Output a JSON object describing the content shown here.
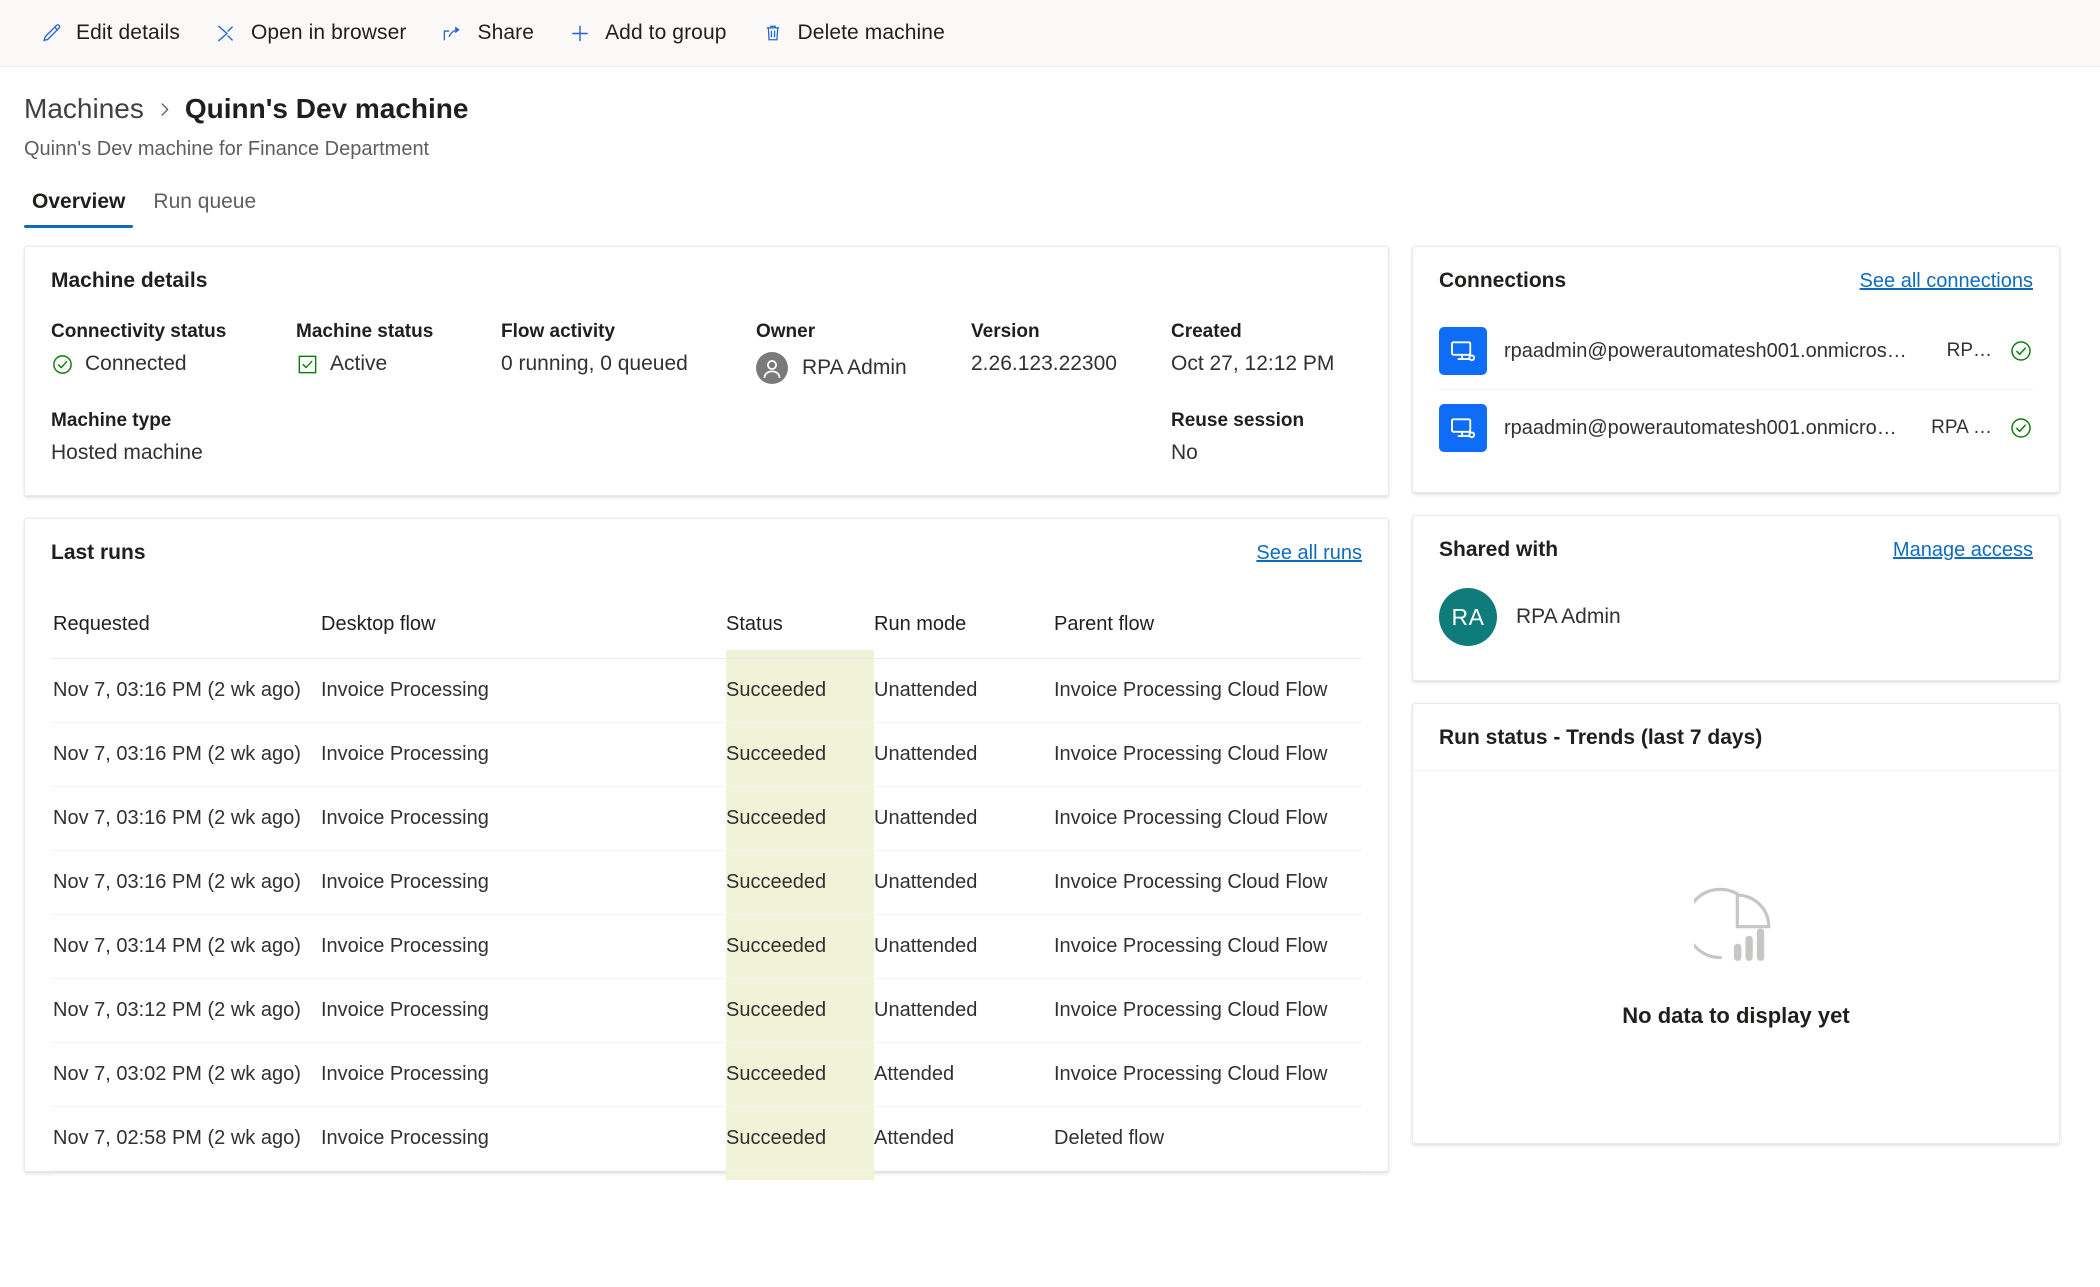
{
  "toolbar": {
    "items": [
      {
        "label": "Edit details",
        "icon": "pencil-icon",
        "name": "edit-details-button"
      },
      {
        "label": "Open in browser",
        "icon": "open-in-browser-icon",
        "name": "open-in-browser-button"
      },
      {
        "label": "Share",
        "icon": "share-icon",
        "name": "share-button"
      },
      {
        "label": "Add to group",
        "icon": "plus-icon",
        "name": "add-to-group-button"
      },
      {
        "label": "Delete machine",
        "icon": "trash-icon",
        "name": "delete-machine-button"
      }
    ]
  },
  "header": {
    "breadcrumb_parent": "Machines",
    "breadcrumb_separator": "›",
    "title": "Quinn's Dev machine",
    "subtitle": "Quinn's Dev machine for Finance Department"
  },
  "tabs": [
    {
      "label": "Overview",
      "active": true
    },
    {
      "label": "Run queue",
      "active": false
    }
  ],
  "machine_details": {
    "title": "Machine details",
    "fields": {
      "connectivity_status_label": "Connectivity status",
      "connectivity_status_value": "Connected",
      "machine_status_label": "Machine status",
      "machine_status_value": "Active",
      "flow_activity_label": "Flow activity",
      "flow_activity_value": "0 running, 0 queued",
      "owner_label": "Owner",
      "owner_value": "RPA Admin",
      "version_label": "Version",
      "version_value": "2.26.123.22300",
      "created_label": "Created",
      "created_value": "Oct 27, 12:12 PM",
      "machine_type_label": "Machine type",
      "machine_type_value": "Hosted machine",
      "reuse_session_label": "Reuse session",
      "reuse_session_value": "No"
    }
  },
  "last_runs": {
    "title": "Last runs",
    "see_all_label": "See all runs",
    "columns": [
      "Requested",
      "Desktop flow",
      "Status",
      "Run mode",
      "Parent flow"
    ],
    "rows": [
      {
        "requested": "Nov 7, 03:16 PM (2 wk ago)",
        "flow": "Invoice Processing",
        "status": "Succeeded",
        "mode": "Unattended",
        "parent": "Invoice Processing Cloud Flow",
        "parent_deleted": false
      },
      {
        "requested": "Nov 7, 03:16 PM (2 wk ago)",
        "flow": "Invoice Processing",
        "status": "Succeeded",
        "mode": "Unattended",
        "parent": "Invoice Processing Cloud Flow",
        "parent_deleted": false
      },
      {
        "requested": "Nov 7, 03:16 PM (2 wk ago)",
        "flow": "Invoice Processing",
        "status": "Succeeded",
        "mode": "Unattended",
        "parent": "Invoice Processing Cloud Flow",
        "parent_deleted": false
      },
      {
        "requested": "Nov 7, 03:16 PM (2 wk ago)",
        "flow": "Invoice Processing",
        "status": "Succeeded",
        "mode": "Unattended",
        "parent": "Invoice Processing Cloud Flow",
        "parent_deleted": false
      },
      {
        "requested": "Nov 7, 03:14 PM (2 wk ago)",
        "flow": "Invoice Processing",
        "status": "Succeeded",
        "mode": "Unattended",
        "parent": "Invoice Processing Cloud Flow",
        "parent_deleted": false
      },
      {
        "requested": "Nov 7, 03:12 PM (2 wk ago)",
        "flow": "Invoice Processing",
        "status": "Succeeded",
        "mode": "Unattended",
        "parent": "Invoice Processing Cloud Flow",
        "parent_deleted": false
      },
      {
        "requested": "Nov 7, 03:02 PM (2 wk ago)",
        "flow": "Invoice Processing",
        "status": "Succeeded",
        "mode": "Attended",
        "parent": "Invoice Processing Cloud Flow",
        "parent_deleted": false
      },
      {
        "requested": "Nov 7, 02:58 PM (2 wk ago)",
        "flow": "Invoice Processing",
        "status": "Succeeded",
        "mode": "Attended",
        "parent": "Deleted flow",
        "parent_deleted": true
      }
    ]
  },
  "connections": {
    "title": "Connections",
    "see_all_label": "See all connections",
    "items": [
      {
        "name": "rpaadmin@powerautomatesh001.onmicros…",
        "owner": "RP…",
        "status": "ok"
      },
      {
        "name": "rpaadmin@powerautomatesh001.onmicro…",
        "owner": "RPA …",
        "status": "ok"
      }
    ]
  },
  "shared_with": {
    "title": "Shared with",
    "manage_label": "Manage access",
    "people": [
      {
        "initials": "RA",
        "name": "RPA Admin"
      }
    ]
  },
  "trends": {
    "title": "Run status - Trends (last 7 days)",
    "empty_text": "No data to display yet",
    "chart_data": {
      "type": "pie",
      "title": "Run status - Trends (last 7 days)",
      "categories": [],
      "values": [],
      "series": [],
      "xlabel": "",
      "ylabel": "",
      "grid": false,
      "legend": "none",
      "empty": true,
      "empty_message": "No data to display yet"
    }
  },
  "colors": {
    "accent": "#0f6cbd",
    "link": "#0f6cbd",
    "success": "#107c10",
    "succeeded_band": "#f0f3d7",
    "connection_tile": "#0f6cf7",
    "avatar_teal": "#0f7b7b",
    "command_icon": "#2564cf"
  }
}
